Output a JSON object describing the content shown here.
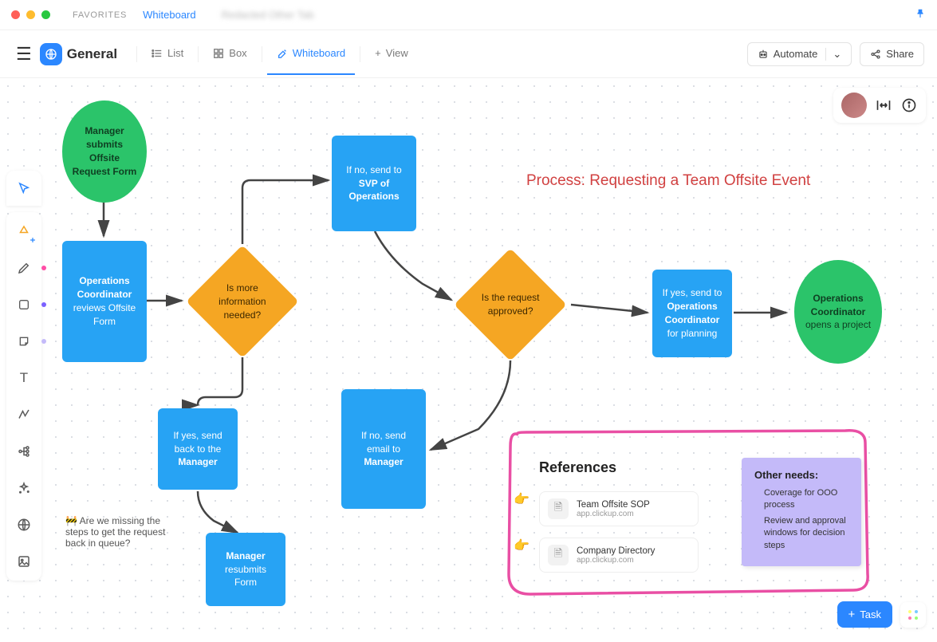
{
  "window": {
    "favorites": "FAVORITES",
    "tabs": [
      "Whiteboard",
      "Redacted Other Tab"
    ]
  },
  "toolbar": {
    "space_title": "General",
    "views": {
      "list": "List",
      "box": "Box",
      "whiteboard": "Whiteboard",
      "add": "View"
    },
    "automate": "Automate",
    "share": "Share"
  },
  "canvas": {
    "title": "Process: Requesting a Team Offsite Event",
    "comment": "🚧 Are we missing the steps to get the request back in queue?",
    "nodes": {
      "start": {
        "line1": "Manager submits Offsite Request Form"
      },
      "review": {
        "bold": "Operations Coordinator",
        "rest": "reviews Offsite Form"
      },
      "moreinfo": "Is more information needed?",
      "sendback": {
        "pre": "If yes, send back to the",
        "bold": "Manager"
      },
      "resubmit": {
        "bold": "Manager",
        "rest": "resubmits Form"
      },
      "svp": {
        "pre": "If no, send to",
        "bold": "SVP of Operations"
      },
      "approved": "Is the request approved?",
      "emailno": {
        "pre": "If no, send email to",
        "bold": "Manager"
      },
      "planning": {
        "pre": "If yes, send to",
        "bold": "Operations Coordinator",
        "post": "for planning"
      },
      "opens": {
        "bold": "Operations Coordinator",
        "rest": "opens a project"
      }
    },
    "references": {
      "heading": "References",
      "cards": [
        {
          "title": "Team Offsite SOP",
          "sub": "app.clickup.com"
        },
        {
          "title": "Company Directory",
          "sub": "app.clickup.com"
        }
      ],
      "needs_title": "Other needs:",
      "needs": [
        "Coverage for OOO process",
        "Review and approval windows for decision steps"
      ]
    }
  },
  "bottom": {
    "task": "Task"
  }
}
